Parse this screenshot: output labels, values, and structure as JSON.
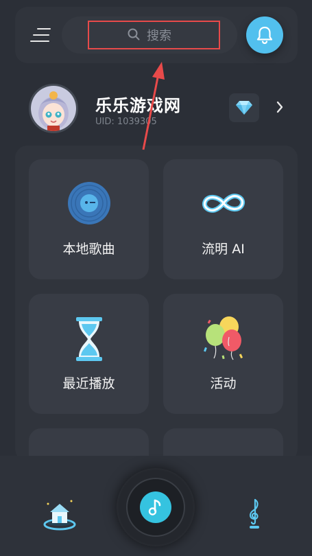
{
  "header": {
    "search": {
      "placeholder": "搜索"
    },
    "icons": {
      "menu": "menu-icon",
      "bell": "bell-icon"
    }
  },
  "profile": {
    "name": "乐乐游戏网",
    "uid": "UID: 1039305",
    "icons": {
      "vip": "diamond-icon",
      "more": "chevron-right-icon"
    }
  },
  "grid": {
    "items": [
      {
        "label": "本地歌曲",
        "icon": "vinyl-record-icon"
      },
      {
        "label": "流明 AI",
        "icon": "infinity-icon"
      },
      {
        "label": "最近播放",
        "icon": "hourglass-icon"
      },
      {
        "label": "活动",
        "icon": "balloons-icon"
      }
    ]
  },
  "bottom_nav": {
    "items": [
      {
        "icon": "home-icon"
      },
      {
        "icon": "music-note-icon"
      },
      {
        "icon": "treble-clef-icon"
      }
    ]
  },
  "colors": {
    "accent": "#52c0ee",
    "play": "#35c3e0",
    "annotation": "#e84a4a",
    "background": "#2b2f37"
  }
}
